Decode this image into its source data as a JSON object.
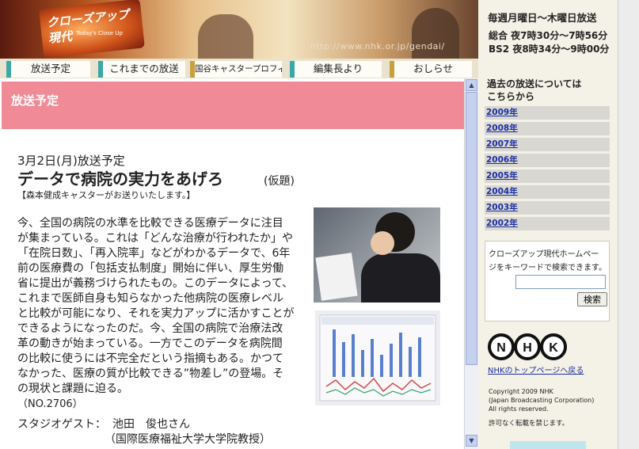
{
  "banner": {
    "logo_text": "クローズアップ現代",
    "logo_sub": "Today's Close Up",
    "url": "http://www.nhk.or.jp/gendai/"
  },
  "schedule": {
    "line1": "毎週月曜日～木曜日放送",
    "line2": "総合 夜7時30分～7時56分",
    "line3": "BS2 夜8時34分～9時00分"
  },
  "nav": {
    "tabs": [
      {
        "label": "放送予定"
      },
      {
        "label": "これまでの放送"
      },
      {
        "label": "国谷キャスタープロフィール"
      },
      {
        "label": "編集長より"
      },
      {
        "label": "おしらせ"
      }
    ]
  },
  "section": {
    "header": "放送予定"
  },
  "article": {
    "date": "3月2日(月)放送予定",
    "title": "データで病院の実力をあげろ",
    "title_suffix": "(仮題)",
    "presenter": "【森本健成キャスターがお送りいたします。】",
    "body_lines": [
      "今、全国の病院の水準を比較できる医療データに注目",
      "が集まっている。これは「どんな治療が行われたか」や",
      "「在院日数」、「再入院率」などがわかるデータで、6年",
      "前の医療費の「包括支払制度」開始に伴い、厚生労働",
      "省に提出が義務づけられたもの。このデータによって、",
      "これまで医師自身も知らなかった他病院の医療レベル",
      "と比較が可能になり、それを実力アップに活かすことが",
      "できるようになったのだ。今、全国の病院で治療法改",
      "革の動きが始まっている。一方でこのデータを病院間",
      "の比較に使うには不完全だという指摘もある。かつて",
      "なかった、医療の質が比較できる”物差し”の登場。そ",
      "の現状と課題に迫る。",
      "（NO.2706）"
    ],
    "guest_label": "スタジオゲスト：",
    "guest_name": "池田　俊也さん",
    "guest_affiliation": "（国際医療福祉大学大学院教授）"
  },
  "sidebar": {
    "archive_heading_1": "過去の放送については",
    "archive_heading_2": "こちらから",
    "years": [
      "2009年",
      "2008年",
      "2007年",
      "2006年",
      "2005年",
      "2004年",
      "2003年",
      "2002年"
    ],
    "search_desc_1": "クローズアップ現代ホームペー",
    "search_desc_2": "ジをキーワードで検索できます。",
    "search_button": "検索",
    "search_value": "",
    "nhk_logo": "NHK",
    "nhk_link": "NHKのトップページへ戻る",
    "copyright_1": "Copyright 2009 NHK",
    "copyright_2": "(Japan Broadcasting Corporation)",
    "copyright_3": "All rights reserved.",
    "reprint_note": "許可なく転載を禁じます。"
  },
  "colors": {
    "section_header_bg": "#f08a96",
    "link": "#1a2ea0",
    "nav_accent_1": "#3aa8a8",
    "nav_accent_2": "#c8a03c"
  },
  "icons": {
    "scroll_up": "triangle-up-icon",
    "scroll_down": "triangle-down-icon"
  }
}
